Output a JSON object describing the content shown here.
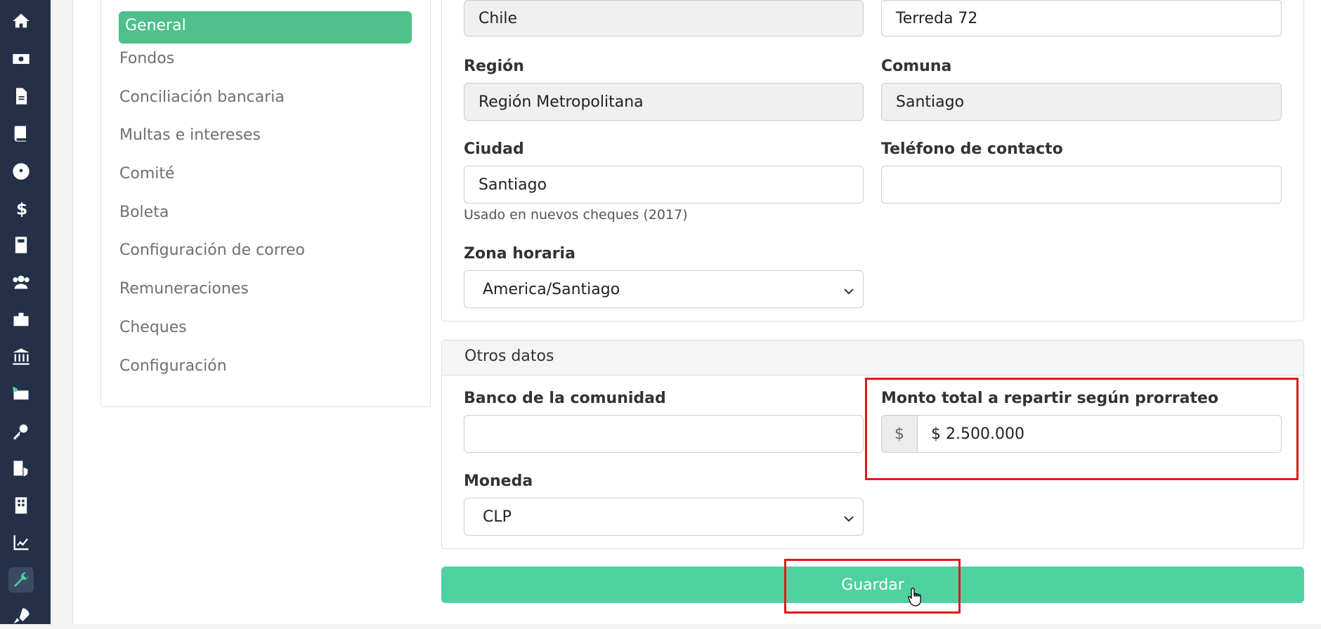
{
  "nav": {
    "icons": [
      "home-icon",
      "money-icon",
      "document-icon",
      "book-icon",
      "dashboard-icon",
      "dollar-icon",
      "calculator-icon",
      "users-icon",
      "briefcase-icon",
      "bank-icon",
      "payments-icon",
      "key-icon",
      "building-shield-icon",
      "building-icon",
      "chart-line-icon",
      "wrench-icon",
      "rocket-icon"
    ],
    "active": "wrench-icon"
  },
  "sidebar": {
    "items": [
      {
        "label": "General",
        "active": true
      },
      {
        "label": "Fondos"
      },
      {
        "label": "Conciliación bancaria"
      },
      {
        "label": "Multas e intereses"
      },
      {
        "label": "Comité"
      },
      {
        "label": "Boleta"
      },
      {
        "label": "Configuración de correo"
      },
      {
        "label": "Remuneraciones"
      },
      {
        "label": "Cheques"
      },
      {
        "label": "Configuración"
      }
    ]
  },
  "form": {
    "country_value": "Chile",
    "address_value": "Terreda 72",
    "region_label": "Región",
    "region_value": "Región Metropolitana",
    "comuna_label": "Comuna",
    "comuna_value": "Santiago",
    "city_label": "Ciudad",
    "city_value": "Santiago",
    "city_help": "Usado en nuevos cheques (2017)",
    "phone_label": "Teléfono de contacto",
    "phone_value": "",
    "timezone_label": "Zona horaria",
    "timezone_value": "America/Santiago"
  },
  "other": {
    "header": "Otros datos",
    "bank_label": "Banco de la comunidad",
    "bank_value": "",
    "total_label": "Monto total a repartir según prorrateo",
    "total_prefix": "$",
    "total_value": "$ 2.500.000",
    "currency_label": "Moneda",
    "currency_value": "CLP"
  },
  "actions": {
    "save_label": "Guardar"
  },
  "colors": {
    "rail": "#243047",
    "accent": "#4fd1a0",
    "active_item": "#4fbf8c",
    "highlight": "#e01919"
  }
}
